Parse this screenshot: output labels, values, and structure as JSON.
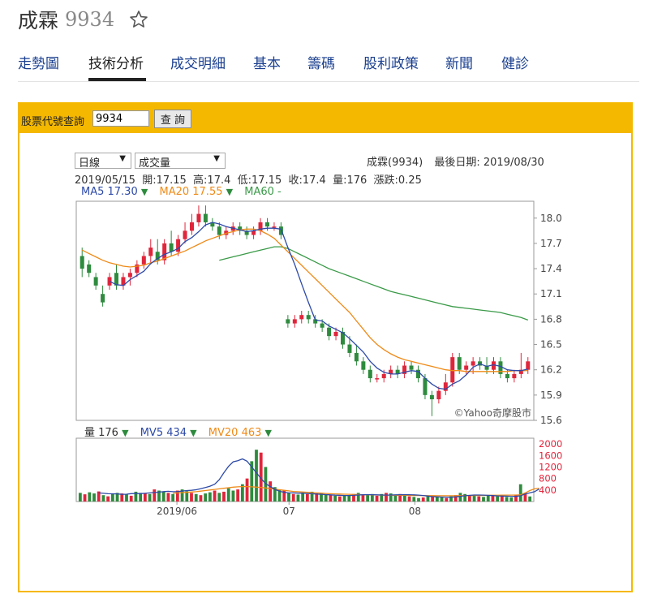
{
  "stock": {
    "name": "成霖",
    "code": "9934"
  },
  "tabs": [
    {
      "label": "走勢圖"
    },
    {
      "label": "技術分析"
    },
    {
      "label": "成交明細"
    },
    {
      "label": "基本"
    },
    {
      "label": "籌碼"
    },
    {
      "label": "股利政策"
    },
    {
      "label": "新聞"
    },
    {
      "label": "健診"
    }
  ],
  "active_tab": "技術分析",
  "query": {
    "label": "股票代號查詢",
    "value": "9934",
    "button": "查 詢"
  },
  "selects": {
    "period": "日線",
    "indicator": "成交量"
  },
  "header": {
    "stock_info": "成霖(9934)",
    "last_date": "最後日期: 2019/08/30"
  },
  "ohlc_line": "2019/05/15  開:17.15  高:17.4  低:17.15  收:17.4  量:176  漲跌:0.25",
  "ma_legend": {
    "ma5": "MA5 17.30",
    "ma20": "MA20 17.55",
    "ma60": "MA60 -"
  },
  "vol_legend": {
    "vol": "量 176",
    "mv5": "MV5 434",
    "mv20": "MV20 463"
  },
  "watermark": "©Yahoo奇摩股市",
  "colors": {
    "up": "#e0253b",
    "down": "#2e8b3e",
    "ma5": "#2d4aa8",
    "ma20": "#ef8a17",
    "ma60": "#3a9a48",
    "accent": "#f5b800",
    "link": "#1a3f8f"
  },
  "chart_data": [
    {
      "type": "candlestick",
      "title": "",
      "x_ticks": [
        "2019/06",
        "07",
        "08"
      ],
      "y_ticks": [
        15.6,
        15.9,
        16.2,
        16.5,
        16.8,
        17.1,
        17.4,
        17.7,
        18.0
      ],
      "ylim": [
        15.6,
        18.2
      ],
      "grid": false,
      "series_names": [
        "MA5",
        "MA20",
        "MA60"
      ],
      "candles": [
        {
          "o": 17.55,
          "h": 17.65,
          "l": 17.3,
          "c": 17.4
        },
        {
          "o": 17.45,
          "h": 17.5,
          "l": 17.3,
          "c": 17.35
        },
        {
          "o": 17.3,
          "h": 17.35,
          "l": 17.15,
          "c": 17.2
        },
        {
          "o": 17.1,
          "h": 17.2,
          "l": 16.95,
          "c": 17.0
        },
        {
          "o": 17.2,
          "h": 17.35,
          "l": 17.15,
          "c": 17.3
        },
        {
          "o": 17.35,
          "h": 17.45,
          "l": 17.15,
          "c": 17.2
        },
        {
          "o": 17.2,
          "h": 17.35,
          "l": 17.15,
          "c": 17.3
        },
        {
          "o": 17.3,
          "h": 17.4,
          "l": 17.2,
          "c": 17.35
        },
        {
          "o": 17.35,
          "h": 17.5,
          "l": 17.3,
          "c": 17.45
        },
        {
          "o": 17.45,
          "h": 17.6,
          "l": 17.4,
          "c": 17.55
        },
        {
          "o": 17.55,
          "h": 17.75,
          "l": 17.45,
          "c": 17.65
        },
        {
          "o": 17.6,
          "h": 17.75,
          "l": 17.45,
          "c": 17.5
        },
        {
          "o": 17.5,
          "h": 17.75,
          "l": 17.45,
          "c": 17.7
        },
        {
          "o": 17.7,
          "h": 17.85,
          "l": 17.55,
          "c": 17.6
        },
        {
          "o": 17.6,
          "h": 17.8,
          "l": 17.55,
          "c": 17.75
        },
        {
          "o": 17.75,
          "h": 17.95,
          "l": 17.7,
          "c": 17.85
        },
        {
          "o": 17.85,
          "h": 18.05,
          "l": 17.8,
          "c": 17.95
        },
        {
          "o": 17.95,
          "h": 18.15,
          "l": 17.9,
          "c": 18.05
        },
        {
          "o": 18.05,
          "h": 18.15,
          "l": 17.9,
          "c": 17.95
        },
        {
          "o": 17.95,
          "h": 18.0,
          "l": 17.85,
          "c": 17.9
        },
        {
          "o": 17.9,
          "h": 17.95,
          "l": 17.75,
          "c": 17.8
        },
        {
          "o": 17.8,
          "h": 17.9,
          "l": 17.75,
          "c": 17.85
        },
        {
          "o": 17.85,
          "h": 17.95,
          "l": 17.8,
          "c": 17.9
        },
        {
          "o": 17.9,
          "h": 17.95,
          "l": 17.8,
          "c": 17.85
        },
        {
          "o": 17.85,
          "h": 17.9,
          "l": 17.75,
          "c": 17.8
        },
        {
          "o": 17.8,
          "h": 17.9,
          "l": 17.75,
          "c": 17.85
        },
        {
          "o": 17.85,
          "h": 18.0,
          "l": 17.8,
          "c": 17.95
        },
        {
          "o": 17.95,
          "h": 18.0,
          "l": 17.85,
          "c": 17.9
        },
        {
          "o": 17.9,
          "h": 17.95,
          "l": 17.85,
          "c": 17.9
        },
        {
          "o": 17.9,
          "h": 17.95,
          "l": 17.75,
          "c": 17.8
        },
        {
          "o": 16.8,
          "h": 16.85,
          "l": 16.7,
          "c": 16.75
        },
        {
          "o": 16.75,
          "h": 16.85,
          "l": 16.7,
          "c": 16.8
        },
        {
          "o": 16.8,
          "h": 16.9,
          "l": 16.75,
          "c": 16.85
        },
        {
          "o": 16.85,
          "h": 16.9,
          "l": 16.75,
          "c": 16.8
        },
        {
          "o": 16.8,
          "h": 16.85,
          "l": 16.7,
          "c": 16.75
        },
        {
          "o": 16.75,
          "h": 16.8,
          "l": 16.65,
          "c": 16.7
        },
        {
          "o": 16.7,
          "h": 16.75,
          "l": 16.55,
          "c": 16.6
        },
        {
          "o": 16.6,
          "h": 16.7,
          "l": 16.55,
          "c": 16.65
        },
        {
          "o": 16.65,
          "h": 16.7,
          "l": 16.45,
          "c": 16.5
        },
        {
          "o": 16.5,
          "h": 16.6,
          "l": 16.35,
          "c": 16.4
        },
        {
          "o": 16.4,
          "h": 16.5,
          "l": 16.25,
          "c": 16.3
        },
        {
          "o": 16.3,
          "h": 16.35,
          "l": 16.15,
          "c": 16.2
        },
        {
          "o": 16.2,
          "h": 16.25,
          "l": 16.05,
          "c": 16.1
        },
        {
          "o": 16.1,
          "h": 16.15,
          "l": 16.05,
          "c": 16.1
        },
        {
          "o": 16.1,
          "h": 16.2,
          "l": 16.05,
          "c": 16.15
        },
        {
          "o": 16.15,
          "h": 16.25,
          "l": 16.1,
          "c": 16.2
        },
        {
          "o": 16.2,
          "h": 16.25,
          "l": 16.1,
          "c": 16.15
        },
        {
          "o": 16.15,
          "h": 16.3,
          "l": 16.1,
          "c": 16.25
        },
        {
          "o": 16.25,
          "h": 16.3,
          "l": 16.15,
          "c": 16.2
        },
        {
          "o": 16.2,
          "h": 16.25,
          "l": 16.05,
          "c": 16.1
        },
        {
          "o": 16.1,
          "h": 16.15,
          "l": 15.85,
          "c": 15.9
        },
        {
          "o": 15.9,
          "h": 15.95,
          "l": 15.65,
          "c": 15.85
        },
        {
          "o": 15.85,
          "h": 16.0,
          "l": 15.8,
          "c": 15.95
        },
        {
          "o": 15.95,
          "h": 16.15,
          "l": 15.9,
          "c": 16.05
        },
        {
          "o": 16.05,
          "h": 16.4,
          "l": 16.0,
          "c": 16.35
        },
        {
          "o": 16.35,
          "h": 16.4,
          "l": 16.15,
          "c": 16.2
        },
        {
          "o": 16.2,
          "h": 16.3,
          "l": 16.15,
          "c": 16.25
        },
        {
          "o": 16.25,
          "h": 16.35,
          "l": 16.15,
          "c": 16.3
        },
        {
          "o": 16.3,
          "h": 16.35,
          "l": 16.2,
          "c": 16.25
        },
        {
          "o": 16.25,
          "h": 16.35,
          "l": 16.15,
          "c": 16.2
        },
        {
          "o": 16.2,
          "h": 16.35,
          "l": 16.15,
          "c": 16.3
        },
        {
          "o": 16.3,
          "h": 16.35,
          "l": 16.1,
          "c": 16.15
        },
        {
          "o": 16.15,
          "h": 16.2,
          "l": 16.05,
          "c": 16.1
        },
        {
          "o": 16.1,
          "h": 16.2,
          "l": 16.05,
          "c": 16.15
        },
        {
          "o": 16.15,
          "h": 16.4,
          "l": 16.1,
          "c": 16.2
        },
        {
          "o": 16.2,
          "h": 16.35,
          "l": 16.15,
          "c": 16.3
        }
      ],
      "ma5": [
        null,
        null,
        null,
        null,
        17.25,
        17.21,
        17.2,
        17.27,
        17.32,
        17.37,
        17.46,
        17.52,
        17.57,
        17.6,
        17.64,
        17.72,
        17.77,
        17.84,
        17.92,
        17.95,
        17.93,
        17.9,
        17.88,
        17.86,
        17.84,
        17.85,
        17.87,
        17.88,
        17.88,
        17.87,
        17.65,
        17.45,
        17.22,
        17.0,
        16.79,
        16.78,
        16.72,
        16.68,
        16.64,
        16.57,
        16.49,
        16.41,
        16.3,
        16.22,
        16.17,
        16.15,
        16.15,
        16.17,
        16.19,
        16.18,
        16.1,
        16.03,
        15.98,
        15.97,
        16.03,
        16.07,
        16.14,
        16.23,
        16.27,
        16.24,
        16.26,
        16.24,
        16.2,
        16.19,
        16.19,
        16.21
      ],
      "ma20": [
        17.62,
        17.58,
        17.54,
        17.5,
        17.47,
        17.45,
        17.43,
        17.42,
        17.43,
        17.44,
        17.47,
        17.49,
        17.52,
        17.55,
        17.58,
        17.61,
        17.65,
        17.69,
        17.73,
        17.76,
        17.79,
        17.82,
        17.84,
        17.86,
        17.87,
        17.87,
        17.85,
        17.81,
        17.76,
        17.68,
        17.6,
        17.52,
        17.44,
        17.36,
        17.28,
        17.2,
        17.12,
        17.04,
        16.96,
        16.88,
        16.78,
        16.68,
        16.58,
        16.5,
        16.44,
        16.39,
        16.35,
        16.32,
        16.3,
        16.28,
        16.26,
        16.24,
        16.22,
        16.2,
        16.19,
        16.19,
        16.18,
        16.18,
        16.18,
        16.18,
        16.18,
        16.18,
        16.18,
        16.19,
        16.19,
        16.19
      ],
      "ma60": [
        null,
        null,
        null,
        null,
        null,
        null,
        null,
        null,
        null,
        null,
        null,
        null,
        null,
        null,
        null,
        null,
        null,
        null,
        null,
        null,
        17.5,
        17.52,
        17.54,
        17.56,
        17.58,
        17.6,
        17.62,
        17.64,
        17.66,
        17.66,
        17.64,
        17.6,
        17.56,
        17.52,
        17.48,
        17.44,
        17.4,
        17.37,
        17.34,
        17.31,
        17.28,
        17.25,
        17.22,
        17.19,
        17.16,
        17.13,
        17.11,
        17.09,
        17.07,
        17.05,
        17.03,
        17.01,
        16.99,
        16.97,
        16.95,
        16.94,
        16.93,
        16.92,
        16.91,
        16.9,
        16.89,
        16.88,
        16.86,
        16.84,
        16.82,
        16.79
      ]
    },
    {
      "type": "bar",
      "title": "",
      "y_ticks": [
        400,
        800,
        1200,
        1600,
        2000
      ],
      "ylim": [
        0,
        2200
      ],
      "volumes": [
        300,
        250,
        320,
        280,
        350,
        220,
        180,
        260,
        300,
        280,
        250,
        200,
        340,
        300,
        280,
        260,
        420,
        380,
        340,
        300,
        260,
        380,
        420,
        360,
        300,
        260,
        220,
        280,
        320,
        380,
        300,
        340,
        460,
        380,
        420,
        600,
        800,
        1400,
        1800,
        1700,
        1200,
        700,
        500,
        420,
        380,
        300,
        260,
        240,
        300,
        260,
        340,
        280,
        300,
        240,
        220,
        200,
        180,
        200,
        220,
        260,
        300,
        240,
        220,
        260,
        200,
        260,
        300,
        280,
        240,
        260,
        200,
        180,
        160,
        120,
        140,
        180,
        200,
        160,
        140,
        120,
        180,
        220,
        300,
        260,
        200,
        240,
        180,
        160,
        200,
        220,
        180,
        200,
        160,
        140,
        220,
        600,
        300,
        176
      ],
      "mv5": [
        null,
        null,
        null,
        null,
        300,
        284,
        270,
        268,
        266,
        248,
        254,
        274,
        280,
        274,
        286,
        300,
        312,
        324,
        344,
        356,
        340,
        344,
        364,
        380,
        390,
        410,
        444,
        486,
        532,
        600,
        760,
        1000,
        1220,
        1380,
        1420,
        1480,
        1400,
        1200,
        1000,
        800,
        620,
        520,
        420,
        360,
        320,
        300,
        300,
        290,
        290,
        280,
        270,
        260,
        250,
        240,
        230,
        220,
        215,
        210,
        210,
        215,
        225,
        235,
        240,
        238,
        230,
        226,
        224,
        226,
        230,
        236,
        240,
        238,
        230,
        222,
        210,
        190,
        170,
        160,
        155,
        152,
        150,
        160,
        180,
        200,
        215,
        225,
        225,
        222,
        215,
        205,
        195,
        190,
        185,
        180,
        178,
        200,
        260,
        300,
        340,
        434
      ],
      "mv20": [
        null,
        null,
        null,
        null,
        null,
        null,
        null,
        null,
        null,
        null,
        null,
        null,
        null,
        null,
        null,
        null,
        null,
        null,
        null,
        null,
        290,
        300,
        310,
        320,
        330,
        340,
        360,
        380,
        400,
        420,
        440,
        460,
        480,
        500,
        510,
        520,
        520,
        510,
        500,
        490,
        470,
        450,
        430,
        410,
        390,
        370,
        350,
        340,
        330,
        320,
        310,
        300,
        290,
        280,
        270,
        265,
        260,
        255,
        250,
        245,
        240,
        235,
        230,
        228,
        226,
        224,
        222,
        220,
        218,
        216,
        214,
        212,
        210,
        208,
        206,
        204,
        202,
        200,
        200,
        200,
        200,
        200,
        202,
        204,
        206,
        208,
        210,
        212,
        214,
        216,
        218,
        220,
        222,
        224,
        226,
        230,
        300,
        380,
        440,
        463
      ]
    }
  ]
}
